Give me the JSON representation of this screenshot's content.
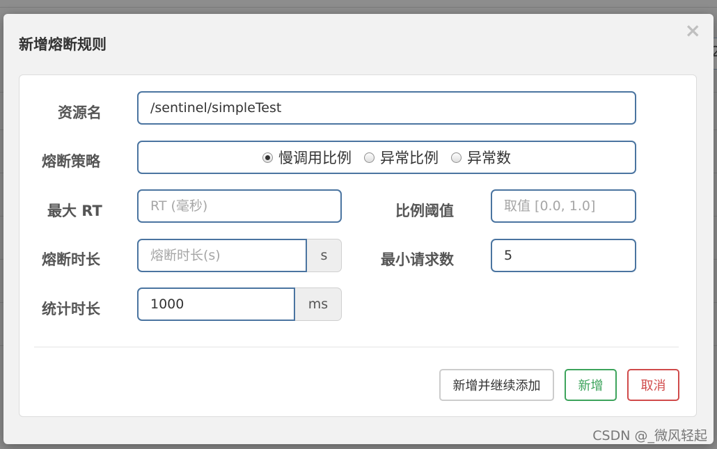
{
  "modal": {
    "title": "新增熔断规则",
    "close_glyph": "×"
  },
  "background": {
    "right_char": "2"
  },
  "form": {
    "resource": {
      "label": "资源名",
      "value": "/sentinel/simpleTest"
    },
    "strategy": {
      "label": "熔断策略",
      "options": [
        {
          "label": "慢调用比例",
          "checked": true
        },
        {
          "label": "异常比例",
          "checked": false
        },
        {
          "label": "异常数",
          "checked": false
        }
      ]
    },
    "max_rt": {
      "label": "最大 RT",
      "value": "",
      "placeholder": "RT (毫秒)"
    },
    "ratio_threshold": {
      "label": "比例阈值",
      "value": "",
      "placeholder": "取值 [0.0, 1.0]"
    },
    "break_duration": {
      "label": "熔断时长",
      "value": "",
      "placeholder": "熔断时长(s)",
      "unit": "s"
    },
    "min_requests": {
      "label": "最小请求数",
      "value": "5"
    },
    "stat_duration": {
      "label": "统计时长",
      "value": "1000",
      "unit": "ms"
    }
  },
  "buttons": {
    "add_continue": "新增并继续添加",
    "add": "新增",
    "cancel": "取消"
  },
  "colors": {
    "input_border": "#4a74a0",
    "success": "#3ca35b",
    "danger": "#d04a4a"
  },
  "watermark": "CSDN @_微风轻起"
}
